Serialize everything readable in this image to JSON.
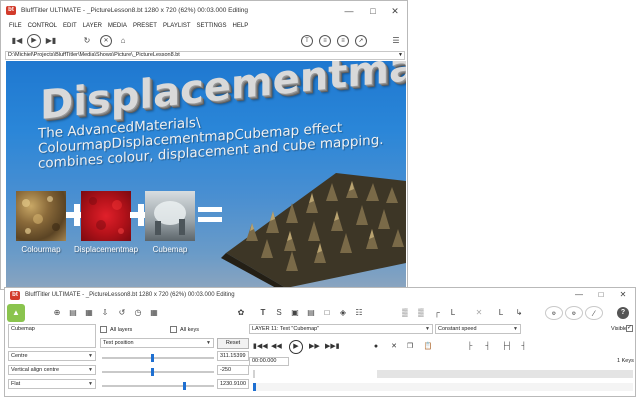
{
  "main_window": {
    "app_icon": "bt-logo-icon",
    "title": "BluffTitler ULTIMATE  - _PictureLesson8.bt 1280 x 720 (62%) 00:03.000 Editing",
    "menu": [
      "FILE",
      "CONTROL",
      "EDIT",
      "LAYER",
      "MEDIA",
      "PRESET",
      "PLAYLIST",
      "SETTINGS",
      "HELP"
    ],
    "path": "D:\\Michiel\\Projects\\BluffTitler\\Media\\Shows\\Picture\\_PictureLesson8.bt",
    "toolbar_icons": [
      "skip-back-icon",
      "play-icon",
      "skip-forward-icon",
      "refresh-icon",
      "stop-icon",
      "home-icon",
      "text-icon",
      "effect-icon",
      "effect-icon",
      "measure-icon",
      "menu-icon"
    ]
  },
  "preview": {
    "title": "Displacementmap",
    "description": [
      "The AdvancedMaterials\\",
      "ColourmapDisplacementmapCubemap effect",
      "combines colour, displacement and cube mapping."
    ],
    "tiles": [
      {
        "label": "Colourmap",
        "color": "#8a6a3a"
      },
      {
        "label": "Displacementmap",
        "color": "#c0141a"
      },
      {
        "label": "Cubemap",
        "color": "#c8cdd0"
      }
    ],
    "result_color": "#5a4a30"
  },
  "control_window": {
    "title": "BluffTitler ULTIMATE  - _PictureLesson8.bt 1280 x 720 (62%) 00:03.000 Editing",
    "text_value": "Cubemap",
    "all_layers_label": "All layers",
    "all_keys_label": "All keys",
    "property_select": "Text position",
    "reset_label": "Reset",
    "layer_select": "LAYER 11: Text \"Cubemap\"",
    "speed_select": "Constant speed",
    "visible_label": "Visible",
    "rows": [
      {
        "select": "Centre",
        "value": "311.15399",
        "level": 0.45
      },
      {
        "select": "Vertical align centre",
        "value": "-250",
        "level": 0.45
      },
      {
        "select": "Flat",
        "value": "1230.9100",
        "level": 0.73
      }
    ],
    "time": "00:00.000",
    "keys_count": "1 Keys",
    "icons": [
      "layer-app-icon",
      "add-icon",
      "add-layer-icon",
      "copy-layer-icon",
      "import-icon",
      "undo-icon",
      "time-icon",
      "grid-icon",
      "brush-icon",
      "text-icon",
      "text-alt-icon",
      "image-icon",
      "video-icon",
      "picture-icon",
      "object-icon",
      "group-icon",
      "light-icon",
      "camera-icon",
      "align-left-icon",
      "align-center-icon",
      "align-right-icon",
      "align-bottom-icon",
      "cross-icon",
      "link-icon",
      "link-alt-icon",
      "gear-icon",
      "gear-alt-icon",
      "ruler-icon",
      "help-icon"
    ],
    "accent": "#1e6fd1"
  }
}
